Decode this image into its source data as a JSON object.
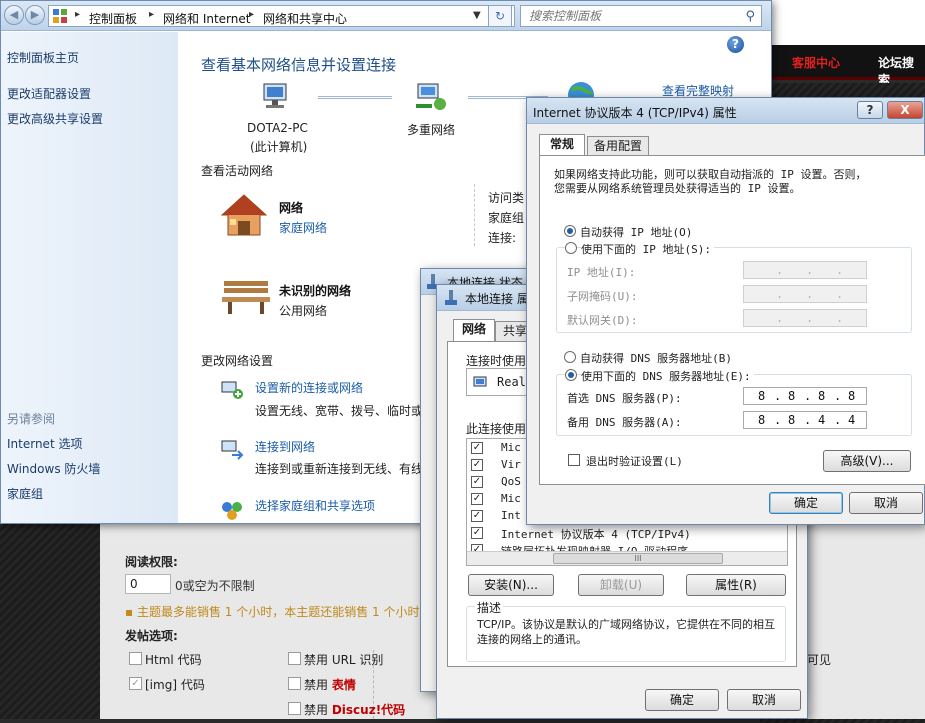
{
  "background_page": {
    "nav_items": [
      "客服中心",
      "论坛搜索"
    ],
    "read_permission_label": "阅读权限:",
    "read_permission_value": "0",
    "read_permission_hint": "0或空为不限制",
    "warning": "主题最多能销售 1 个小时，本主题还能销售 1 个小时",
    "post_options_label": "发帖选项:",
    "options": [
      "Html 代码",
      "[img] 代码",
      "禁用 URL 识别",
      "禁用",
      "表情",
      "禁用",
      "Discuz!代码"
    ],
    "right_text": "可见"
  },
  "control_panel": {
    "breadcrumbs": [
      "控制面板",
      "网络和 Internet",
      "网络和共享中心"
    ],
    "search_placeholder": "搜索控制面板",
    "sidebar": {
      "home": "控制面板主页",
      "items": [
        "更改适配器设置",
        "更改高级共享设置"
      ],
      "see_also_heading": "另请参阅",
      "see_also": [
        "Internet 选项",
        "Windows 防火墙",
        "家庭组"
      ]
    },
    "title": "查看基本网络信息并设置连接",
    "view_full_map": "查看完整映射",
    "map": {
      "computer_name": "DOTA2-PC",
      "computer_sub": "(此计算机)",
      "middle": "多重网络"
    },
    "active_networks_heading": "查看活动网络",
    "networks": [
      {
        "name": "网络",
        "type": "家庭网络"
      },
      {
        "name": "未识别的网络",
        "type": "公用网络"
      }
    ],
    "detail_labels": [
      "访问类",
      "家庭组",
      "连接:"
    ],
    "change_settings_heading": "更改网络设置",
    "tasks": [
      {
        "title": "设置新的连接或网络",
        "desc": "设置无线、宽带、拨号、临时或"
      },
      {
        "title": "连接到网络",
        "desc": "连接到或重新连接到无线、有线"
      },
      {
        "title": "选择家庭组和共享选项",
        "desc": ""
      }
    ]
  },
  "local_conn_back": {
    "title": "本地连接 状态"
  },
  "local_conn": {
    "title": "本地连接 属性",
    "tabs": [
      "网络",
      "共享"
    ],
    "connect_using": "连接时使用:",
    "adapter": "Realt",
    "items_heading": "此连接使用",
    "items": [
      "Mic",
      "Vir",
      "QoS",
      "Mic",
      "Int",
      "Internet 协议版本 4 (TCP/IPv4)",
      "链路层拓扑发现映射器 I/O 驱动程序"
    ],
    "buttons": {
      "install": "安装(N)...",
      "uninstall": "卸载(U)",
      "properties": "属性(R)"
    },
    "description_heading": "描述",
    "description": "TCP/IP。该协议是默认的广域网络协议，它提供在不同的相互连接的网络上的通讯。",
    "ok": "确定",
    "cancel": "取消",
    "scroll_mid": "III"
  },
  "ipv4": {
    "title": "Internet 协议版本 4 (TCP/IPv4) 属性",
    "help_btn": "?",
    "close_btn": "X",
    "tabs": [
      "常规",
      "备用配置"
    ],
    "intro_line1": "如果网络支持此功能，则可以获取自动指派的 IP 设置。否则，",
    "intro_line2": "您需要从网络系统管理员处获得适当的 IP 设置。",
    "auto_ip": "自动获得 IP 地址(O)",
    "use_ip": "使用下面的 IP 地址(S):",
    "ip_address": "IP 地址(I):",
    "subnet_mask": "子网掩码(U):",
    "default_gateway": "默认网关(D):",
    "auto_dns": "自动获得 DNS 服务器地址(B)",
    "use_dns": "使用下面的 DNS 服务器地址(E):",
    "preferred_dns_label": "首选 DNS 服务器(P):",
    "preferred_dns": [
      "8",
      "8",
      "8",
      "8"
    ],
    "alternate_dns_label": "备用 DNS 服务器(A):",
    "alternate_dns": [
      "8",
      "8",
      "4",
      "4"
    ],
    "dot": ".",
    "validate": "退出时验证设置(L)",
    "advanced": "高级(V)...",
    "ok": "确定",
    "cancel": "取消"
  }
}
